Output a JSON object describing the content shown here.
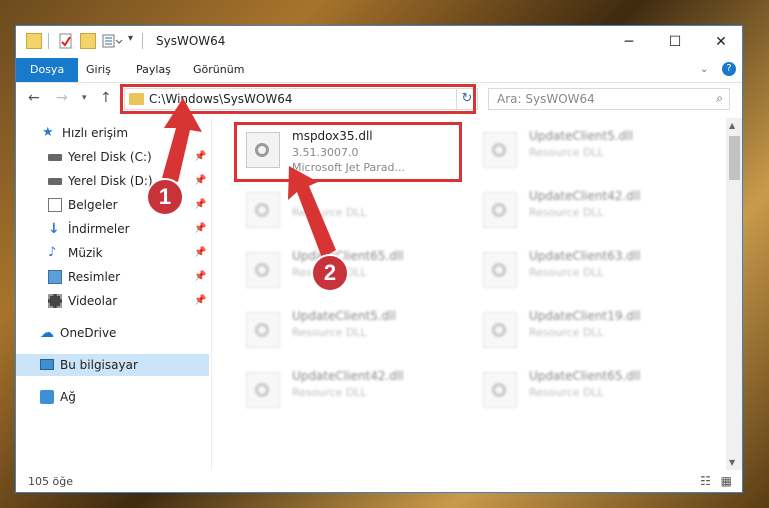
{
  "window": {
    "title": "SysWOW64"
  },
  "ribbon": {
    "tabs": [
      "Dosya",
      "Giriş",
      "Paylaş",
      "Görünüm"
    ]
  },
  "address": {
    "path": "C:\\Windows\\SysWOW64"
  },
  "search": {
    "placeholder": "Ara: SysWOW64"
  },
  "sidebar": {
    "items": [
      {
        "label": "Hızlı erişim",
        "icon": "star-icon"
      },
      {
        "label": "Yerel Disk (C:)",
        "icon": "drive-icon"
      },
      {
        "label": "Yerel Disk (D:)",
        "icon": "drive-icon"
      },
      {
        "label": "Belgeler",
        "icon": "documents-icon"
      },
      {
        "label": "İndirmeler",
        "icon": "download-icon"
      },
      {
        "label": "Müzik",
        "icon": "music-icon"
      },
      {
        "label": "Resimler",
        "icon": "pictures-icon"
      },
      {
        "label": "Videolar",
        "icon": "videos-icon"
      },
      {
        "label": "OneDrive",
        "icon": "cloud-icon"
      },
      {
        "label": "Bu bilgisayar",
        "icon": "computer-icon"
      },
      {
        "label": "Ağ",
        "icon": "network-icon"
      }
    ]
  },
  "files": [
    {
      "name": "mspdox35.dll",
      "version": "3.51.3007.0",
      "desc": "Microsoft Jet Parad..."
    },
    {
      "name": "UpdateClient5.dll",
      "desc": "Resource DLL"
    },
    {
      "name": "",
      "desc": "Resource DLL"
    },
    {
      "name": "UpdateClient42.dll",
      "desc": "Resource DLL"
    },
    {
      "name": "UpdateClient65.dll",
      "desc": "Resource DLL"
    },
    {
      "name": "UpdateClient63.dll",
      "desc": "Resource DLL"
    },
    {
      "name": "UpdateClient5.dll",
      "desc": "Resource DLL"
    },
    {
      "name": "UpdateClient19.dll",
      "desc": "Resource DLL"
    },
    {
      "name": "UpdateClient42.dll",
      "desc": "Resource DLL"
    },
    {
      "name": "UpdateClient65.dll",
      "desc": "Resource DLL"
    }
  ],
  "status": {
    "count": "105 öğe"
  },
  "annotations": {
    "badge1": "1",
    "badge2": "2"
  },
  "colors": {
    "accent": "#1979ca",
    "highlight": "#d93434",
    "badge": "#c8323a"
  }
}
